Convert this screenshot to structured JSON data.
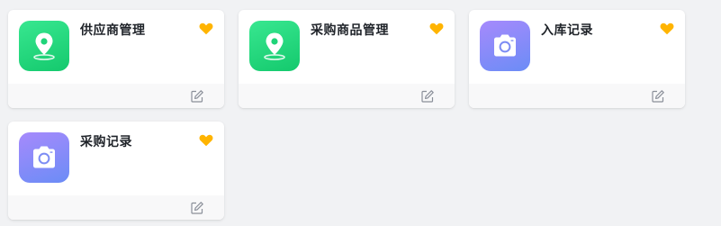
{
  "cards": [
    {
      "title": "供应商管理",
      "icon": "map-pin-icon",
      "icon_color": "green",
      "favorited": true,
      "edit_icon": "edit-icon"
    },
    {
      "title": "采购商品管理",
      "icon": "map-pin-icon",
      "icon_color": "green",
      "favorited": true,
      "edit_icon": "edit-icon"
    },
    {
      "title": "入库记录",
      "icon": "camera-icon",
      "icon_color": "purple",
      "favorited": true,
      "edit_icon": "edit-icon"
    },
    {
      "title": "采购记录",
      "icon": "camera-icon",
      "icon_color": "purple",
      "favorited": true,
      "edit_icon": "edit-icon"
    }
  ],
  "colors": {
    "favorite": "#ffb400",
    "green_from": "#38e790",
    "green_to": "#14c96d",
    "purple_from": "#a68afc",
    "purple_to": "#6b8cf6",
    "background": "#f1f2f4"
  }
}
